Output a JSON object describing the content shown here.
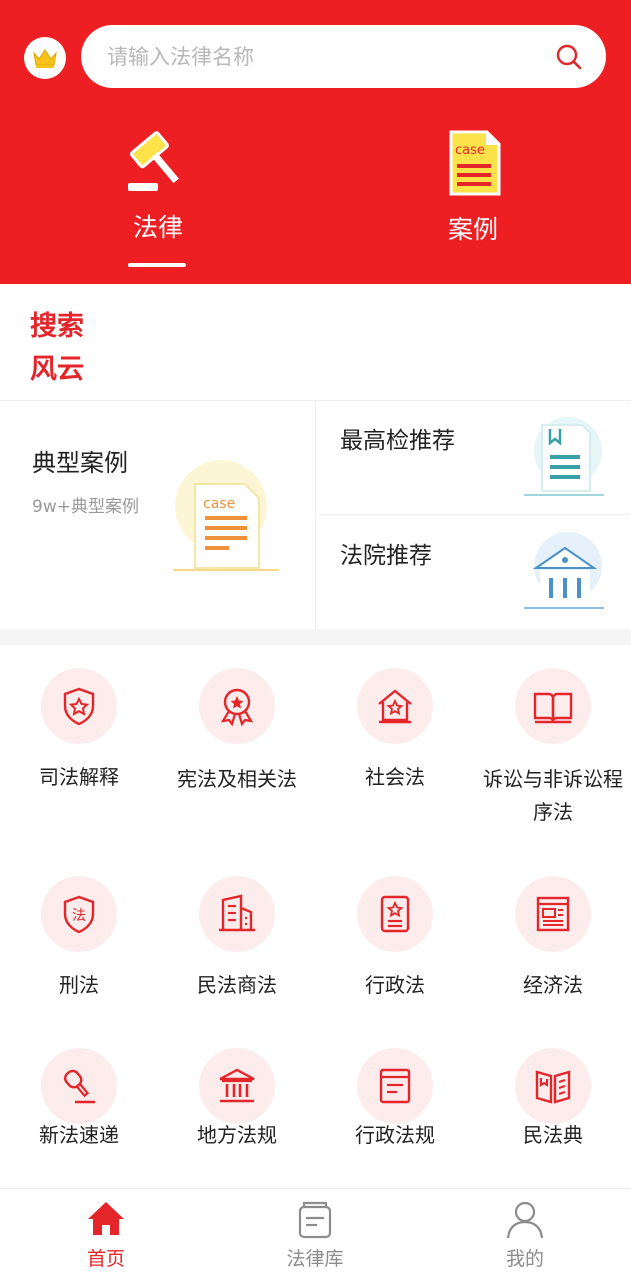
{
  "colors": {
    "primary": "#ee1f22",
    "accent_text": "#e4262b",
    "icon_bg": "#fdecec"
  },
  "search": {
    "placeholder": "请输入法律名称",
    "value": ""
  },
  "header": {
    "crown_icon": "crown-icon",
    "tabs": [
      {
        "label": "法律",
        "icon": "gavel-icon",
        "active": true
      },
      {
        "label": "案例",
        "icon": "case-document-icon",
        "active": false
      }
    ]
  },
  "trending": {
    "title_line1": "搜索",
    "title_line2": "风云"
  },
  "cards": {
    "main": {
      "title": "典型案例",
      "subtitle": "9w+典型案例",
      "icon": "case-document-icon"
    },
    "procuratorate": {
      "title": "最高检推荐",
      "icon": "bookmark-document-icon"
    },
    "court": {
      "title": "法院推荐",
      "icon": "courthouse-icon"
    }
  },
  "categories": [
    {
      "label": "司法解释",
      "icon": "shield-star-icon"
    },
    {
      "label": "宪法及相关法",
      "icon": "medal-icon"
    },
    {
      "label": "社会法",
      "icon": "house-star-icon"
    },
    {
      "label": "诉讼与非诉讼程序法",
      "icon": "open-book-icon"
    },
    {
      "label": "刑法",
      "icon": "shield-law-icon"
    },
    {
      "label": "民法商法",
      "icon": "buildings-icon"
    },
    {
      "label": "行政法",
      "icon": "badge-star-icon"
    },
    {
      "label": "经济法",
      "icon": "newspaper-icon"
    },
    {
      "label": "新法速递",
      "icon": "stamp-icon"
    },
    {
      "label": "地方法规",
      "icon": "government-building-icon"
    },
    {
      "label": "行政法规",
      "icon": "document-icon"
    },
    {
      "label": "民法典",
      "icon": "book-icon"
    }
  ],
  "bottom_nav": [
    {
      "label": "首页",
      "icon": "home-icon",
      "active": true
    },
    {
      "label": "法律库",
      "icon": "library-icon",
      "active": false
    },
    {
      "label": "我的",
      "icon": "user-icon",
      "active": false
    }
  ]
}
